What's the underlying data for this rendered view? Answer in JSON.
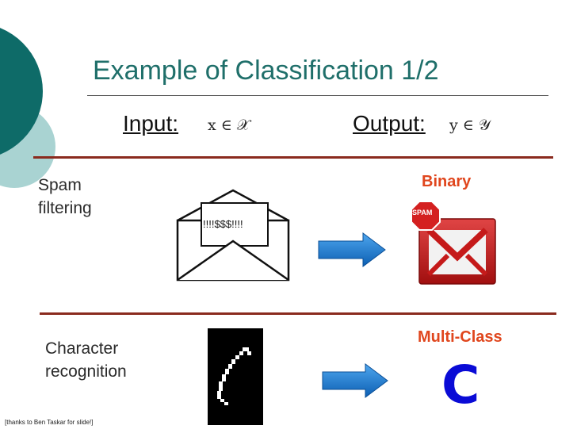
{
  "slide": {
    "title": "Example of Classification 1/2",
    "input_label": "Input:",
    "input_math": "x ∈ 𝒳",
    "output_label": "Output:",
    "output_math": "y ∈ 𝒴",
    "credit": "[thanks to Ben Taskar for slide!]"
  },
  "rows": [
    {
      "task_line1": "Spam",
      "task_line2": "filtering",
      "envelope_text": "!!!!$$$!!!!",
      "output_type": "Binary",
      "output_icon_text": "SPAM"
    },
    {
      "task_line1": "Character",
      "task_line2": "recognition",
      "output_type": "Multi-Class",
      "output_value": "C"
    }
  ],
  "colors": {
    "title": "#1f6f6a",
    "rule": "#8a2a1e",
    "output_type": "#e0461d",
    "arrow": "#1a6fc6",
    "big_letter": "#0a0bd6",
    "deco_dark": "#0e6b68",
    "deco_light": "#a9d3d2"
  }
}
